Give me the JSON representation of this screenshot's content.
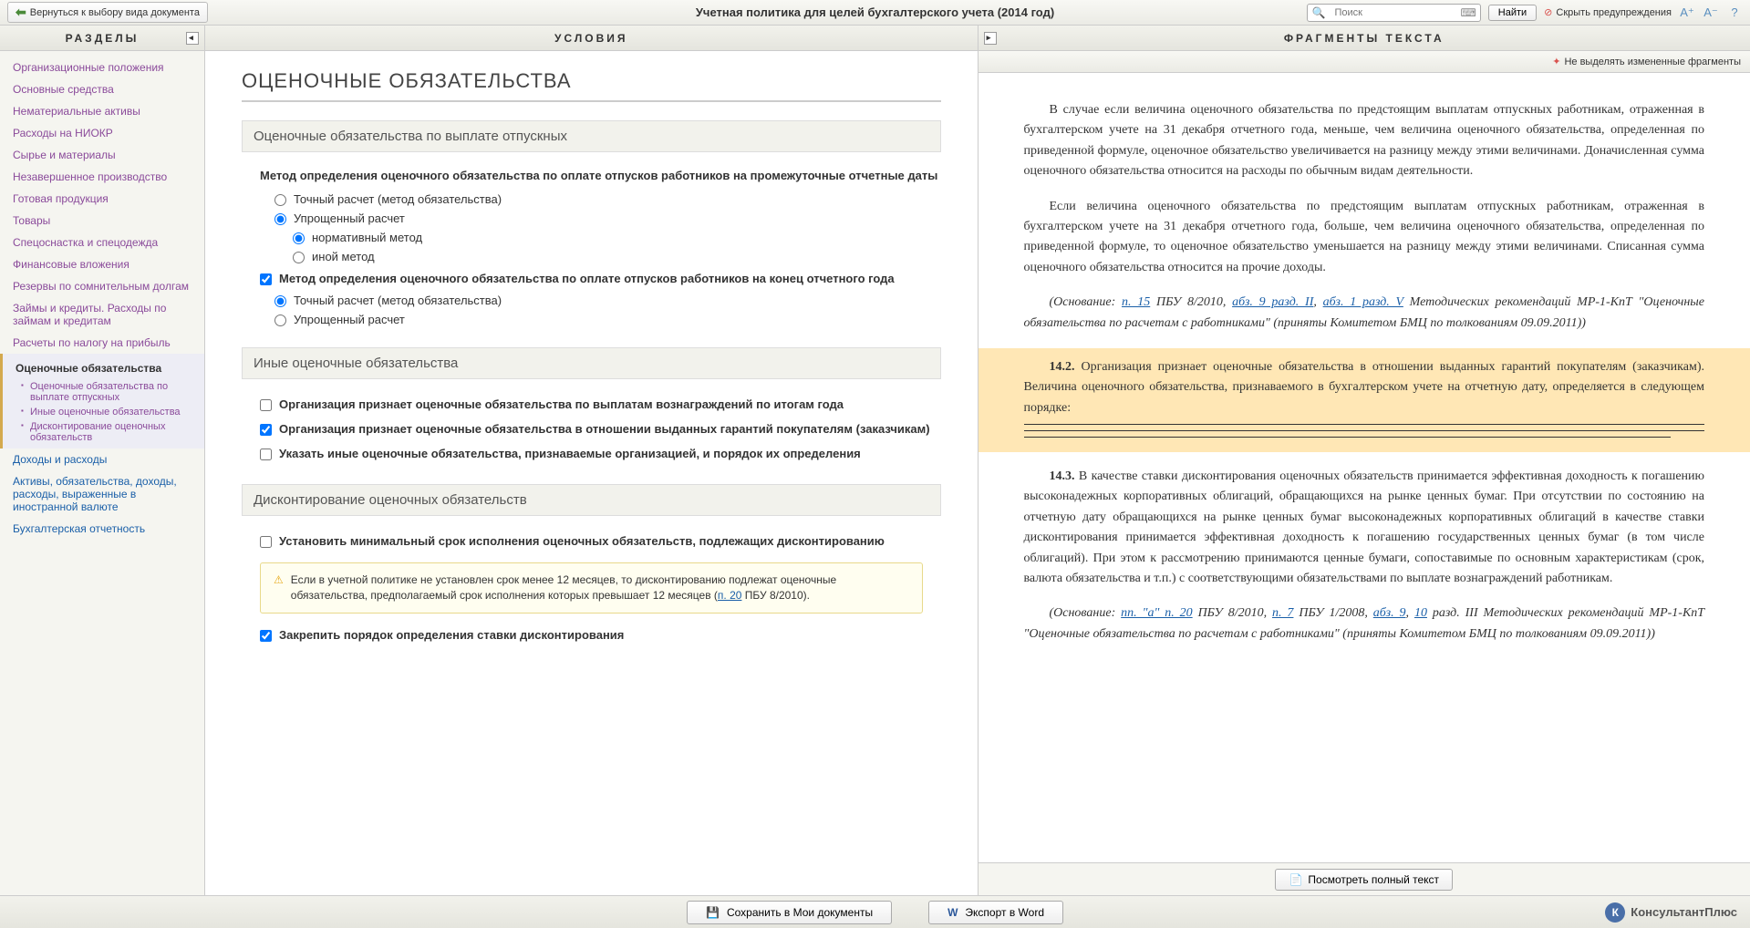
{
  "toolbar": {
    "back": "Вернуться к выбору вида документа",
    "title": "Учетная политика для целей бухгалтерского учета (2014 год)",
    "search_placeholder": "Поиск",
    "find": "Найти",
    "hide_warnings": "Скрыть предупреждения"
  },
  "sidebar": {
    "header": "РАЗДЕЛЫ",
    "items": [
      {
        "label": "Организационные положения",
        "visited": true
      },
      {
        "label": "Основные средства",
        "visited": true
      },
      {
        "label": "Нематериальные активы",
        "visited": true
      },
      {
        "label": "Расходы на НИОКР",
        "visited": true
      },
      {
        "label": "Сырье и материалы",
        "visited": true
      },
      {
        "label": "Незавершенное производство",
        "visited": true
      },
      {
        "label": "Готовая продукция",
        "visited": true
      },
      {
        "label": "Товары",
        "visited": true
      },
      {
        "label": "Спецоснастка и спецодежда",
        "visited": true
      },
      {
        "label": "Финансовые вложения",
        "visited": true
      },
      {
        "label": "Резервы по сомнительным долгам",
        "visited": true
      },
      {
        "label": "Займы и кредиты. Расходы по займам и кредитам",
        "visited": true
      },
      {
        "label": "Расчеты по налогу на прибыль",
        "visited": true
      }
    ],
    "active": {
      "label": "Оценочные обязательства",
      "subs": [
        "Оценочные обязательства по выплате отпускных",
        "Иные оценочные обязательства",
        "Дисконтирование оценочных обязательств"
      ]
    },
    "rest": [
      {
        "label": "Доходы и расходы"
      },
      {
        "label": "Активы, обязательства, доходы, расходы, выраженные в иностранной валюте"
      },
      {
        "label": "Бухгалтерская отчетность"
      }
    ]
  },
  "conditions": {
    "header": "УСЛОВИЯ",
    "h1": "ОЦЕНОЧНЫЕ ОБЯЗАТЕЛЬСТВА",
    "sec1": {
      "title": "Оценочные обязательства по выплате отпускных",
      "q1": "Метод определения оценочного обязательства по оплате отпусков работников на промежуточные отчетные даты",
      "opt1a": "Точный расчет (метод обязательства)",
      "opt1b": "Упрощенный расчет",
      "opt1b1": "нормативный метод",
      "opt1b2": "иной метод",
      "q2": "Метод определения оценочного обязательства по оплате отпусков работников на конец отчетного года",
      "opt2a": "Точный расчет (метод обязательства)",
      "opt2b": "Упрощенный расчет"
    },
    "sec2": {
      "title": "Иные оценочные обязательства",
      "c1": "Организация признает оценочные обязательства по выплатам вознаграждений по итогам года",
      "c2": "Организация признает оценочные обязательства в отношении выданных гарантий покупателям (заказчикам)",
      "c3": "Указать иные оценочные обязательства, признаваемые организацией, и порядок их определения"
    },
    "sec3": {
      "title": "Дисконтирование оценочных обязательств",
      "c1": "Установить минимальный срок исполнения оценочных обязательств, подлежащих дисконтированию",
      "warn": "Если в учетной политике не установлен срок менее 12 месяцев, то дисконтированию подлежат оценочные обязательства, предполагаемый срок исполнения которых превышает 12 месяцев (",
      "warn_link": "п. 20",
      "warn_tail": " ПБУ 8/2010).",
      "c2": "Закрепить порядок определения ставки дисконтирования"
    }
  },
  "fragments": {
    "header": "ФРАГМЕНТЫ ТЕКСТА",
    "toggle": "Не выделять измененные фрагменты",
    "p1": "В случае если величина оценочного обязательства по предстоящим выплатам отпускных работникам, отраженная в бухгалтерском учете на 31 декабря отчетного года, меньше, чем величина оценочного обязательства, определенная по приведенной формуле, оценочное обязательство увеличивается на разницу между этими величинами. Доначисленная сумма оценочного обязательства относится на расходы по обычным видам деятельности.",
    "p2": "Если величина оценочного обязательства по предстоящим выплатам отпускных работникам, отраженная в бухгалтерском учете на 31 декабря отчетного года, больше, чем величина оценочного обязательства, определенная по приведенной формуле, то оценочное обязательство уменьшается на разницу между этими величинами. Списанная сумма оценочного обязательства относится на прочие доходы.",
    "p3_pre": "(Основание: ",
    "p3_l1": "п. 15",
    "p3_m1": " ПБУ 8/2010, ",
    "p3_l2": "абз. 9 разд. II",
    "p3_m2": ", ",
    "p3_l3": "абз. 1 разд. V",
    "p3_post": " Методических рекомендаций МР-1-КпТ \"Оценочные обязательства по расчетам с работниками\" (приняты Комитетом БМЦ по толкованиям 09.09.2011))",
    "hl_num": "14.2.",
    "hl_text": " Организация признает оценочные обязательства в отношении выданных гарантий покупателям (заказчикам). Величина оценочного обязательства, признаваемого в бухгалтерском учете на отчетную дату, определяется в следующем порядке: ",
    "p4_num": "14.3.",
    "p4": " В качестве ставки дисконтирования оценочных обязательств принимается эффективная доходность к погашению высоконадежных корпоративных облигаций, обращающихся на рынке ценных бумаг. При отсутствии по состоянию на отчетную дату обращающихся на рынке ценных бумаг высоконадежных корпоративных облигаций в качестве ставки дисконтирования принимается эффективная доходность к погашению государственных ценных бумаг (в том числе облигаций). При этом к рассмотрению принимаются ценные бумаги, сопоставимые по основным характеристикам (срок, валюта обязательства и т.п.) с соответствующими обязательствами по выплате вознаграждений работникам.",
    "p5_pre": "(Основание: ",
    "p5_l1": "пп. \"а\" п. 20",
    "p5_m1": " ПБУ 8/2010, ",
    "p5_l2": "п. 7",
    "p5_m2": " ПБУ 1/2008, ",
    "p5_l3": "абз. 9",
    "p5_m3": ", ",
    "p5_l4": "10",
    "p5_post": " разд. III Методических рекомендаций МР-1-КпТ \"Оценочные обязательства по расчетам с работниками\" (приняты Комитетом БМЦ по толкованиям 09.09.2011))",
    "view_full": "Посмотреть полный текст"
  },
  "bottom": {
    "save": "Сохранить в Мои документы",
    "export": "Экспорт в Word",
    "logo": "КонсультантПлюс"
  }
}
